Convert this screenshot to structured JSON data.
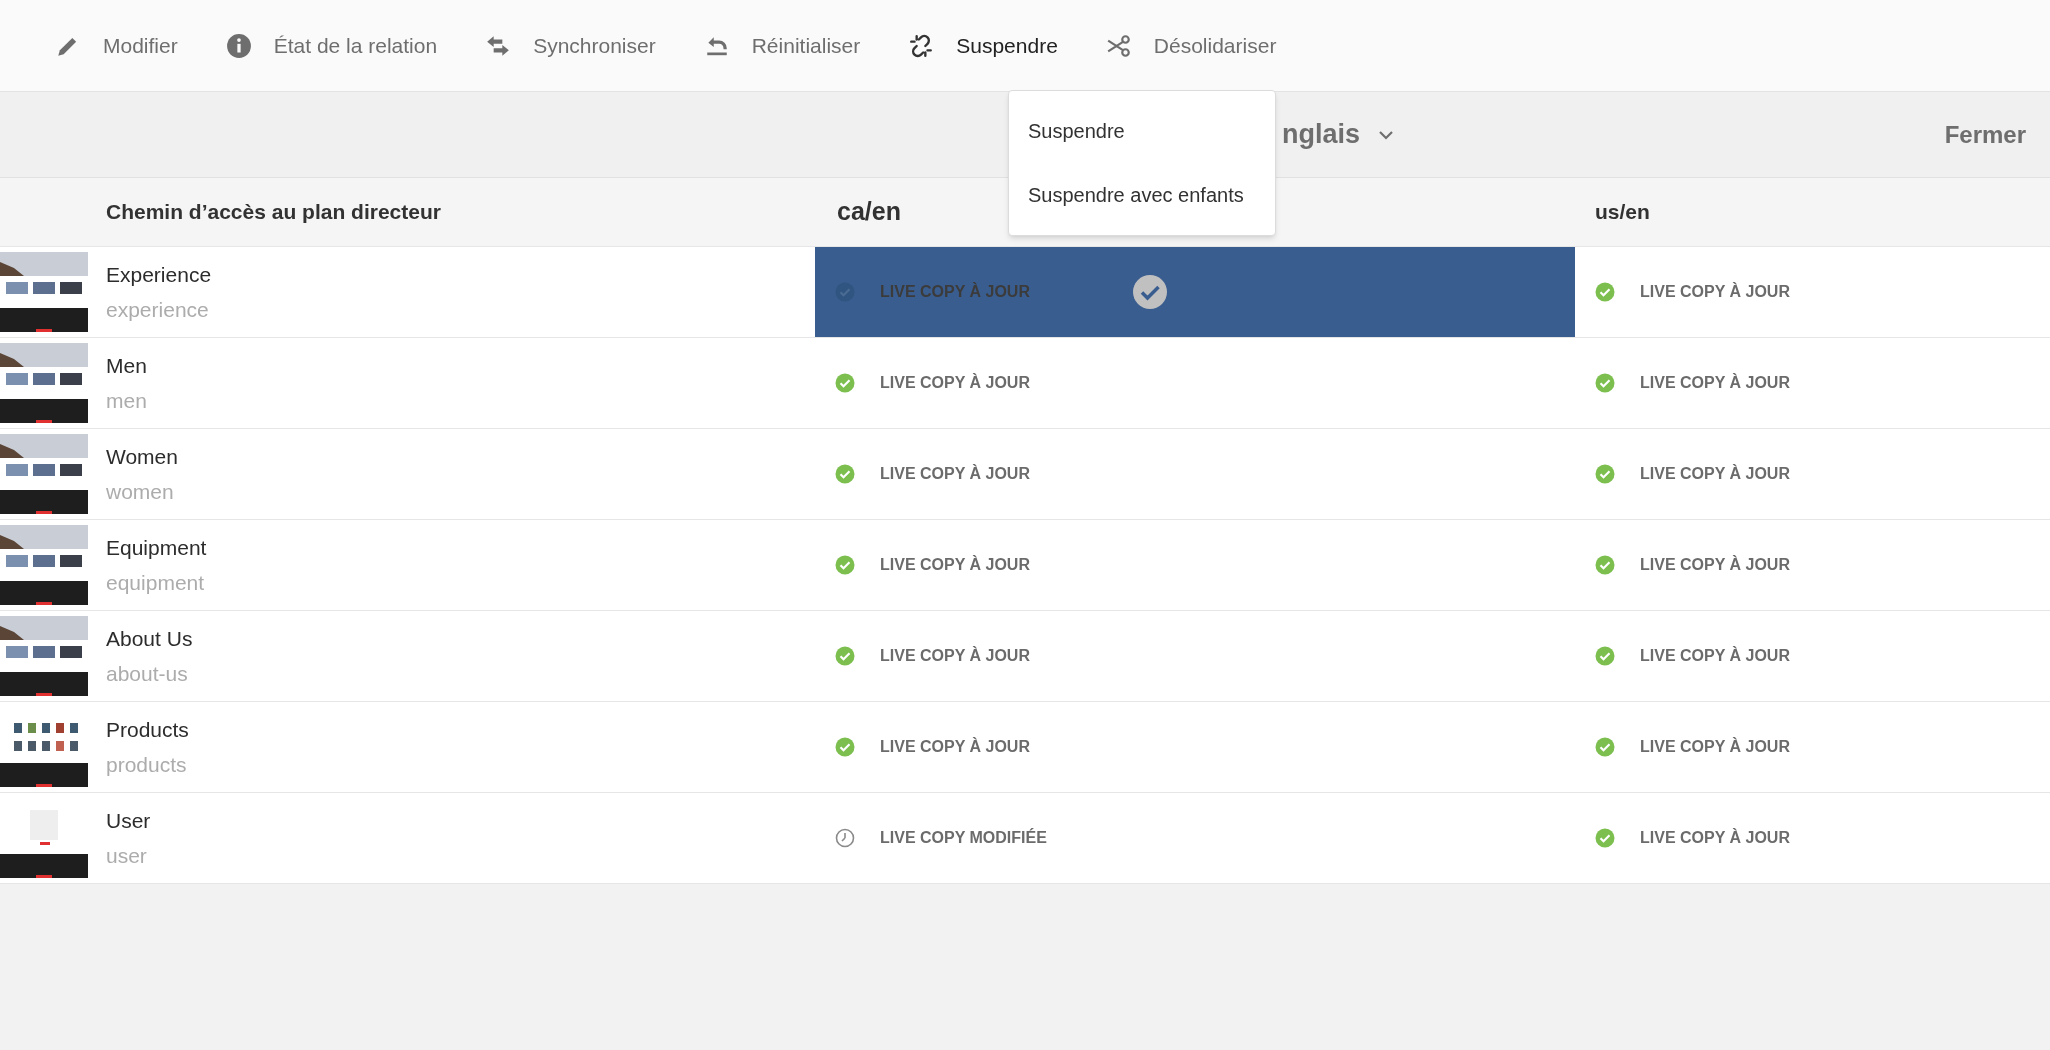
{
  "toolbar": [
    {
      "kind": "edit",
      "label": "Modifier",
      "active": false
    },
    {
      "kind": "info",
      "label": "État de la relation",
      "active": false
    },
    {
      "kind": "sync",
      "label": "Synchroniser",
      "active": false
    },
    {
      "kind": "reset",
      "label": "Réinitialiser",
      "active": false
    },
    {
      "kind": "suspend",
      "label": "Suspendre",
      "active": true
    },
    {
      "kind": "detach",
      "label": "Désolidariser",
      "active": false
    }
  ],
  "menu": {
    "items": [
      "Suspendre",
      "Suspendre avec enfants"
    ]
  },
  "header": {
    "language": "nglais",
    "close": "Fermer"
  },
  "table": {
    "columns": [
      "Chemin d’accès au plan directeur",
      "ca/en",
      "us/en"
    ],
    "rows": [
      {
        "name": "Experience",
        "path": "experience",
        "cells": [
          {
            "kind": "up_to_date",
            "label": "LIVE COPY À JOUR",
            "selected": true
          },
          {
            "kind": "up_to_date",
            "label": "LIVE COPY À JOUR",
            "selected": false
          }
        ]
      },
      {
        "name": "Men",
        "path": "men",
        "cells": [
          {
            "kind": "up_to_date",
            "label": "LIVE COPY À JOUR",
            "selected": false
          },
          {
            "kind": "up_to_date",
            "label": "LIVE COPY À JOUR",
            "selected": false
          }
        ]
      },
      {
        "name": "Women",
        "path": "women",
        "cells": [
          {
            "kind": "up_to_date",
            "label": "LIVE COPY À JOUR",
            "selected": false
          },
          {
            "kind": "up_to_date",
            "label": "LIVE COPY À JOUR",
            "selected": false
          }
        ]
      },
      {
        "name": "Equipment",
        "path": "equipment",
        "cells": [
          {
            "kind": "up_to_date",
            "label": "LIVE COPY À JOUR",
            "selected": false
          },
          {
            "kind": "up_to_date",
            "label": "LIVE COPY À JOUR",
            "selected": false
          }
        ]
      },
      {
        "name": "About Us",
        "path": "about-us",
        "cells": [
          {
            "kind": "up_to_date",
            "label": "LIVE COPY À JOUR",
            "selected": false
          },
          {
            "kind": "up_to_date",
            "label": "LIVE COPY À JOUR",
            "selected": false
          }
        ]
      },
      {
        "name": "Products",
        "path": "products",
        "cells": [
          {
            "kind": "up_to_date",
            "label": "LIVE COPY À JOUR",
            "selected": false
          },
          {
            "kind": "up_to_date",
            "label": "LIVE COPY À JOUR",
            "selected": false
          }
        ]
      },
      {
        "name": "User",
        "path": "user",
        "cells": [
          {
            "kind": "modified",
            "label": "LIVE COPY MODIFIÉE",
            "selected": false
          },
          {
            "kind": "up_to_date",
            "label": "LIVE COPY À JOUR",
            "selected": false
          }
        ]
      }
    ]
  }
}
